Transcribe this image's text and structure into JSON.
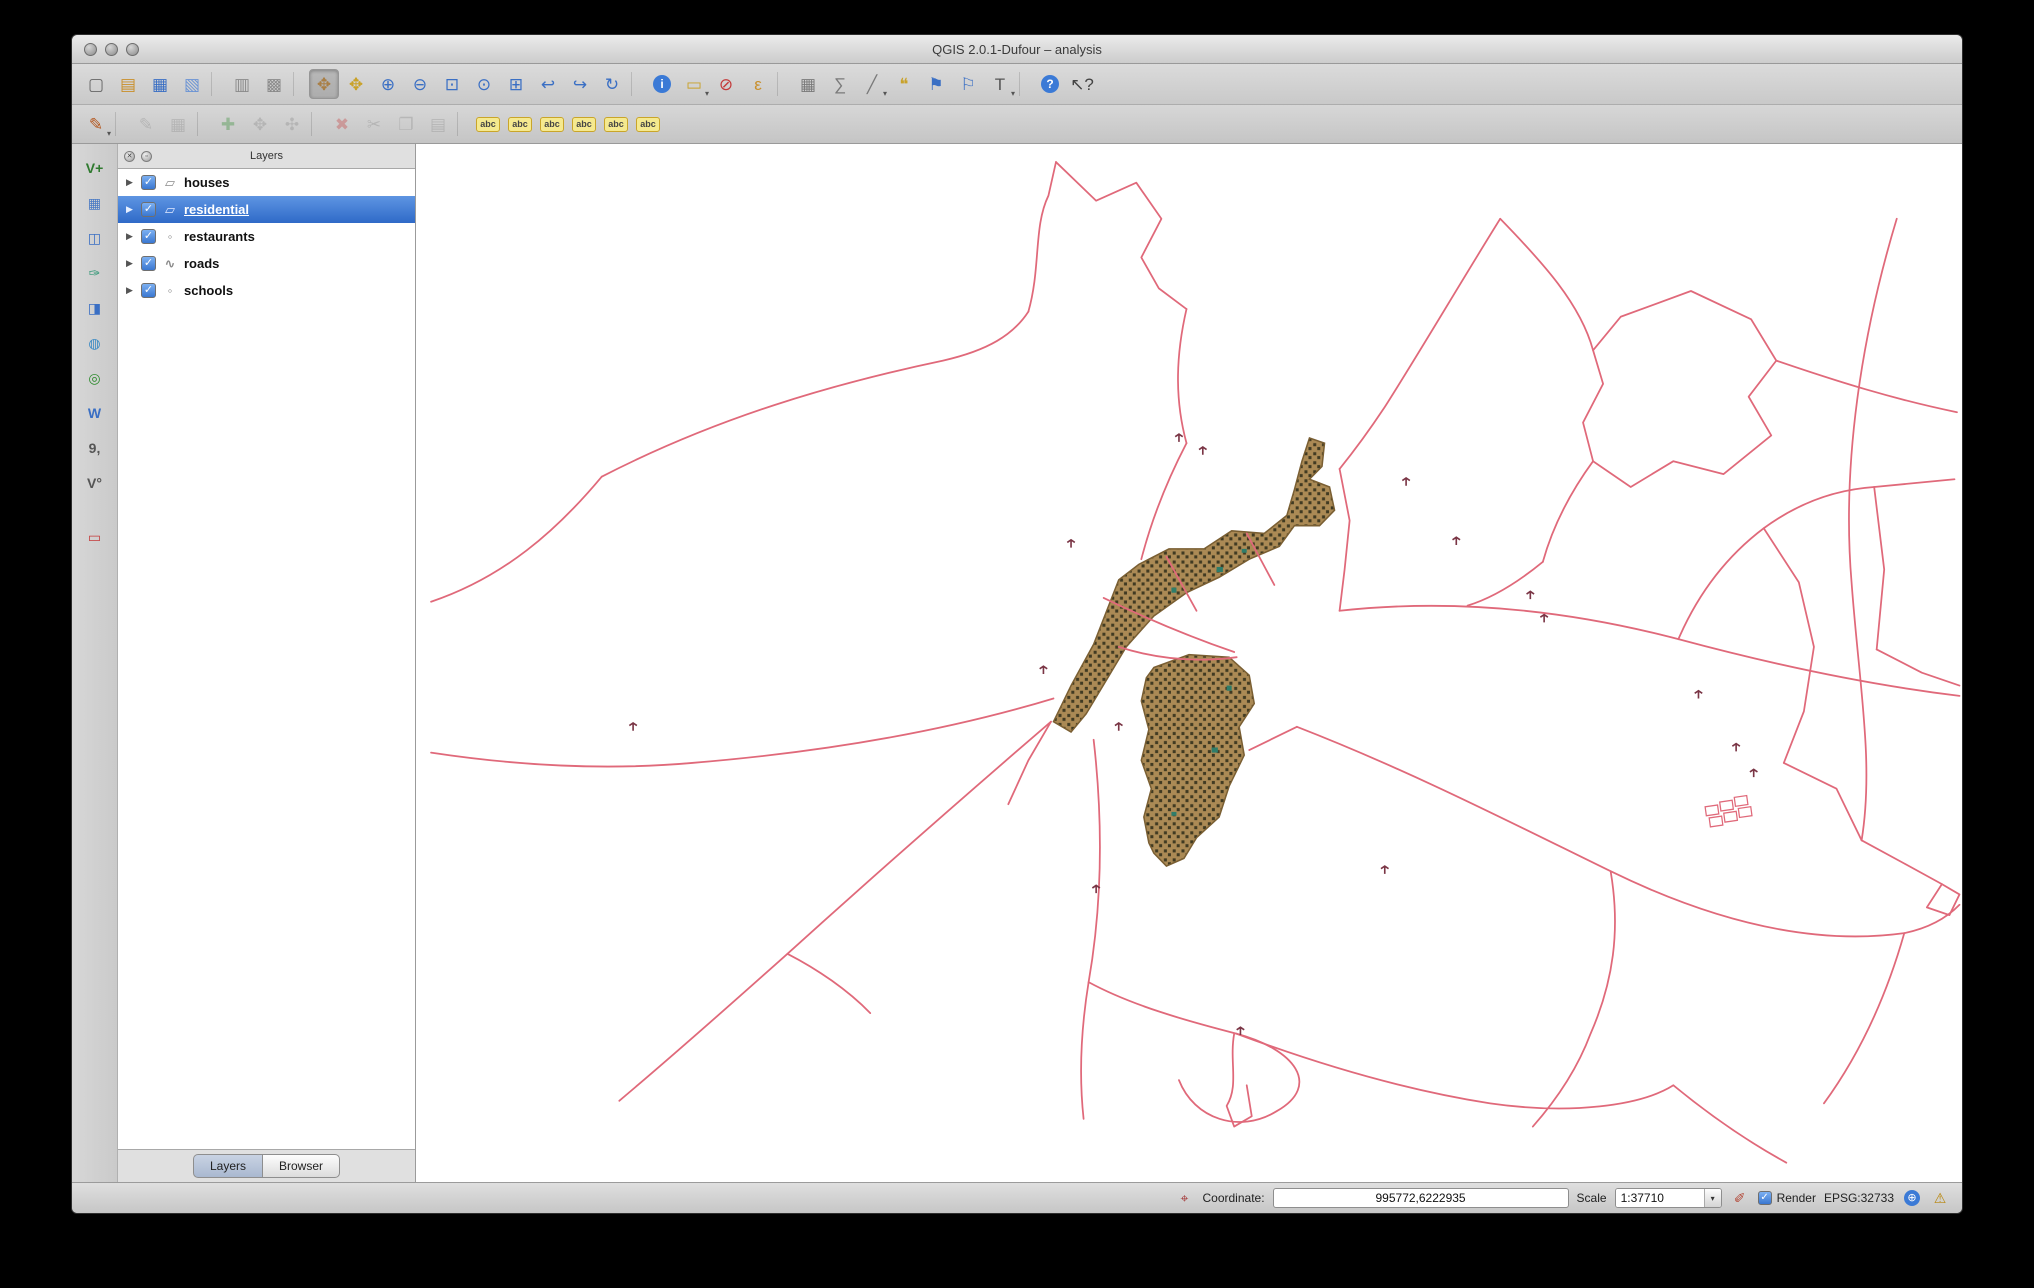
{
  "window": {
    "title": "QGIS 2.0.1-Dufour – analysis"
  },
  "glyphs": {
    "coordinate_target": "⌖",
    "magnifier_edit": "✐",
    "crs_plus": "⊕",
    "warning": "⚠",
    "dropdown_arrow": "▾",
    "check": "✓",
    "disclosure": "▶",
    "panel_close": "✕",
    "panel_float": "▫"
  },
  "toolbars": {
    "main": [
      {
        "name": "new-project-icon",
        "glyph": "▢",
        "color": "#666666"
      },
      {
        "name": "open-project-icon",
        "glyph": "▤",
        "color": "#c98f2a"
      },
      {
        "name": "save-project-icon",
        "glyph": "▦",
        "color": "#3a6fc4"
      },
      {
        "name": "save-project-as-icon",
        "glyph": "▧",
        "color": "#6a93d4"
      },
      {
        "sep": true
      },
      {
        "name": "new-print-composer-icon",
        "glyph": "▥",
        "color": "#8a8a8a"
      },
      {
        "name": "composer-manager-icon",
        "glyph": "▩",
        "color": "#8a8a8a"
      },
      {
        "sep": true
      },
      {
        "name": "pan-map-icon",
        "glyph": "✥",
        "color": "#a97f46",
        "active": true
      },
      {
        "name": "pan-to-selection-icon",
        "glyph": "✥",
        "color": "#c9a22a"
      },
      {
        "name": "zoom-in-icon",
        "glyph": "⊕",
        "color": "#3a6fc4"
      },
      {
        "name": "zoom-out-icon",
        "glyph": "⊖",
        "color": "#3a6fc4"
      },
      {
        "name": "zoom-full-icon",
        "glyph": "⊡",
        "color": "#3a6fc4"
      },
      {
        "name": "zoom-to-selection-icon",
        "glyph": "⊙",
        "color": "#3a6fc4"
      },
      {
        "name": "zoom-to-layer-icon",
        "glyph": "⊞",
        "color": "#3a6fc4"
      },
      {
        "name": "zoom-last-icon",
        "glyph": "↩",
        "color": "#3a6fc4"
      },
      {
        "name": "zoom-next-icon",
        "glyph": "↪",
        "color": "#3a6fc4"
      },
      {
        "name": "refresh-map-icon",
        "glyph": "↻",
        "color": "#3a6fc4"
      },
      {
        "sep": true
      },
      {
        "name": "identify-features-icon",
        "glyph": "i",
        "round": true
      },
      {
        "name": "select-features-icon",
        "glyph": "▭",
        "color": "#c9a22a",
        "caret": true
      },
      {
        "name": "deselect-features-icon",
        "glyph": "⊘",
        "color": "#c43a3a"
      },
      {
        "name": "select-by-expression-icon",
        "glyph": "ε",
        "color": "#c98f2a"
      },
      {
        "sep": true
      },
      {
        "name": "open-attribute-table-icon",
        "glyph": "▦",
        "color": "#7a7a7a"
      },
      {
        "name": "field-calculator-icon",
        "glyph": "∑",
        "color": "#7a7a7a"
      },
      {
        "name": "measure-icon",
        "glyph": "╱",
        "color": "#7a7a7a",
        "caret": true
      },
      {
        "name": "map-tips-icon",
        "glyph": "❝",
        "color": "#c9a22a"
      },
      {
        "name": "new-bookmark-icon",
        "glyph": "⚑",
        "color": "#3a6fc4"
      },
      {
        "name": "show-bookmarks-icon",
        "glyph": "⚐",
        "color": "#3a6fc4"
      },
      {
        "name": "text-annotation-icon",
        "glyph": "T",
        "color": "#555555",
        "caret": true
      },
      {
        "sep": true
      },
      {
        "name": "help-icon",
        "glyph": "?",
        "round": true
      },
      {
        "name": "whats-this-icon",
        "glyph": "↖?",
        "color": "#444444"
      }
    ],
    "editing": [
      {
        "name": "current-edits-icon",
        "glyph": "✎",
        "color": "#b4571e",
        "caret": true
      },
      {
        "sep": true
      },
      {
        "name": "toggle-editing-icon",
        "glyph": "✎",
        "color": "#888888",
        "disabled": true
      },
      {
        "name": "save-layer-edits-icon",
        "glyph": "▦",
        "color": "#888888",
        "disabled": true
      },
      {
        "sep": true
      },
      {
        "name": "add-feature-icon",
        "glyph": "✚",
        "color": "#2e8b2e",
        "disabled": true
      },
      {
        "name": "move-feature-icon",
        "glyph": "✥",
        "color": "#888888",
        "disabled": true
      },
      {
        "name": "node-tool-icon",
        "glyph": "✣",
        "color": "#888888",
        "disabled": true
      },
      {
        "sep": true
      },
      {
        "name": "delete-selected-icon",
        "glyph": "✖",
        "color": "#c43a3a",
        "disabled": true
      },
      {
        "name": "cut-features-icon",
        "glyph": "✂",
        "color": "#888888",
        "disabled": true
      },
      {
        "name": "copy-features-icon",
        "glyph": "❐",
        "color": "#888888",
        "disabled": true
      },
      {
        "name": "paste-features-icon",
        "glyph": "▤",
        "color": "#888888",
        "disabled": true
      },
      {
        "sep": true
      },
      {
        "name": "labeling-options-icon",
        "glyph": "abc",
        "abc": true
      },
      {
        "name": "label-pin-icon",
        "glyph": "abc",
        "abc": true
      },
      {
        "name": "label-show-hidden-icon",
        "glyph": "abc",
        "abc": true
      },
      {
        "name": "label-move-icon",
        "glyph": "abc",
        "abc": true
      },
      {
        "name": "label-rotate-icon",
        "glyph": "abc",
        "abc": true
      },
      {
        "name": "label-properties-icon",
        "glyph": "abc",
        "abc": true
      }
    ],
    "layers_manage": [
      {
        "name": "add-vector-layer-icon",
        "glyph": "V+",
        "color": "#2f7a2f"
      },
      {
        "name": "add-raster-layer-icon",
        "glyph": "▦",
        "color": "#4a7ac4"
      },
      {
        "name": "add-postgis-layer-icon",
        "glyph": "◫",
        "color": "#3a6fc4"
      },
      {
        "name": "add-spatialite-layer-icon",
        "glyph": "✑",
        "color": "#3a9a7a"
      },
      {
        "name": "add-mssql-layer-icon",
        "glyph": "◨",
        "color": "#3a6fc4"
      },
      {
        "name": "add-wms-layer-icon",
        "glyph": "◍",
        "color": "#3a8ac4"
      },
      {
        "name": "add-wcs-layer-icon",
        "glyph": "◎",
        "color": "#2e8b2e"
      },
      {
        "name": "add-wfs-layer-icon",
        "glyph": "W",
        "color": "#3a6fc4"
      },
      {
        "name": "add-delimited-text-icon",
        "glyph": "9,",
        "color": "#555555"
      },
      {
        "name": "new-shapefile-layer-icon",
        "glyph": "V°",
        "color": "#555555"
      },
      {
        "gap": true
      },
      {
        "name": "remove-layer-icon",
        "glyph": "▭",
        "color": "#c43a3a"
      }
    ]
  },
  "layers_panel": {
    "title": "Layers",
    "type_glyphs": {
      "polygon": "▱",
      "line": "∿",
      "point": "◦"
    },
    "items": [
      {
        "label": "houses",
        "type": "polygon",
        "checked": true,
        "selected": false
      },
      {
        "label": "residential",
        "type": "polygon",
        "checked": true,
        "selected": true
      },
      {
        "label": "restaurants",
        "type": "point",
        "checked": true,
        "selected": false
      },
      {
        "label": "roads",
        "type": "line",
        "checked": true,
        "selected": false
      },
      {
        "label": "schools",
        "type": "point",
        "checked": true,
        "selected": false
      }
    ],
    "tabs": [
      {
        "label": "Layers",
        "active": true
      },
      {
        "label": "Browser",
        "active": false
      }
    ]
  },
  "status_bar": {
    "coordinate_label": "Coordinate:",
    "coordinate_value": "995772,6222935",
    "scale_label": "Scale",
    "scale_value": "1:37710",
    "render_label": "Render",
    "crs_label": "EPSG:32733"
  },
  "map": {
    "background": "#ffffff",
    "road_color": "#e0697a",
    "residential_fill": "#ab8a55",
    "residential_outline": "#7a5f33",
    "house_dot_color": "#403a22",
    "marker_color": "#7a3545",
    "vegetation_color": "#2f7d6a"
  },
  "accent_colors": {
    "selection_blue": "#3b76d0"
  }
}
